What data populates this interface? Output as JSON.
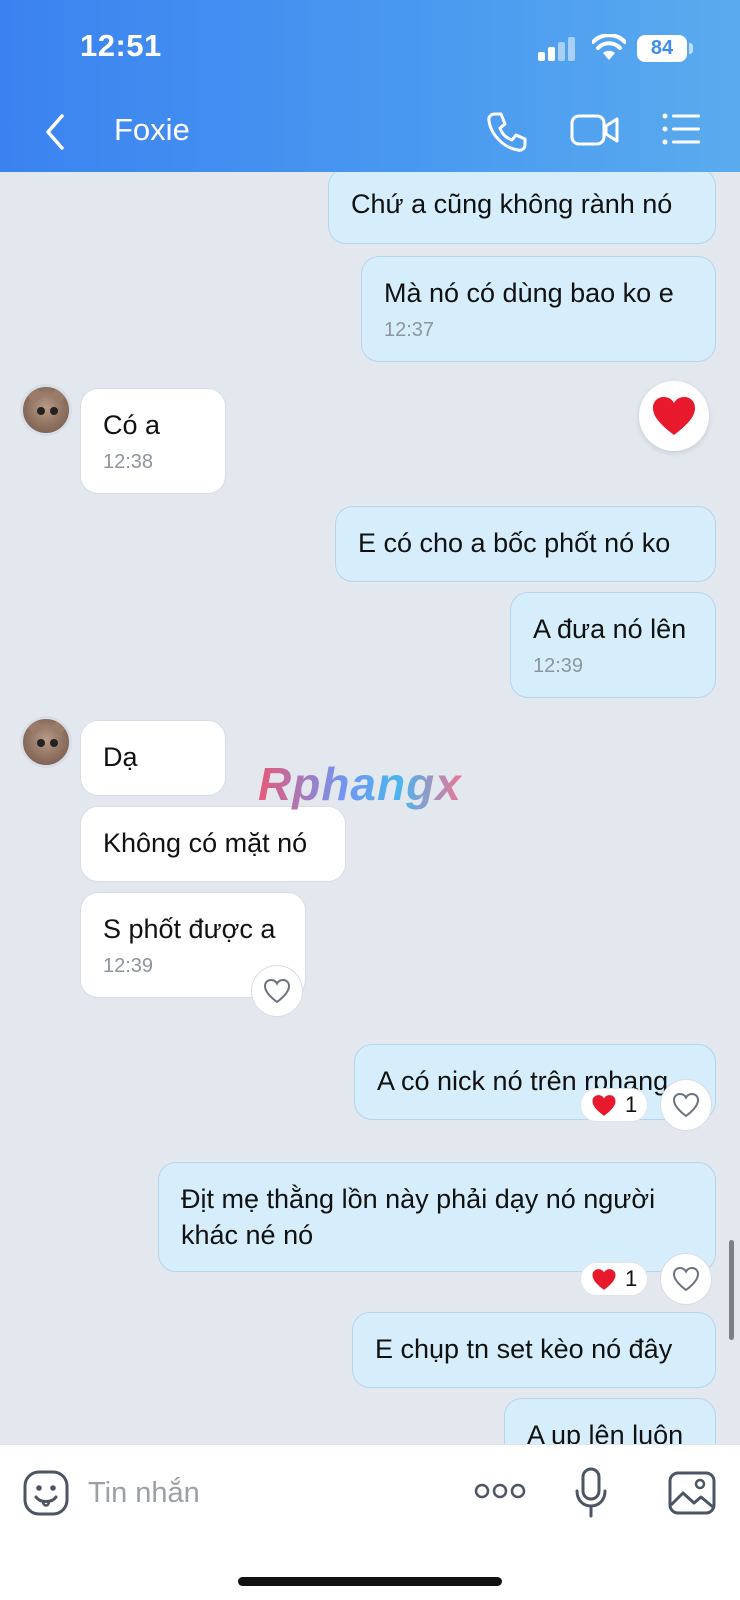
{
  "status_bar": {
    "time": "12:51",
    "battery": "84"
  },
  "header": {
    "title": "Foxie"
  },
  "watermark": "Rphangx",
  "messages": [
    {
      "text": "Chứ a cũng không rành nó",
      "time": ""
    },
    {
      "text": "Mà nó có dùng bao ko e",
      "time": "12:37"
    },
    {
      "text": "Có a",
      "time": "12:38"
    },
    {
      "text": "E có cho a bốc phốt nó ko",
      "time": ""
    },
    {
      "text": "A đưa nó lên",
      "time": "12:39"
    },
    {
      "text": "Dạ",
      "time": ""
    },
    {
      "text": "Không có mặt nó",
      "time": ""
    },
    {
      "text": "S phốt được a",
      "time": "12:39"
    },
    {
      "text": "A có nick nó trên rphang",
      "time": "",
      "reaction_count": "1"
    },
    {
      "text": "Địt mẹ thằng lồn này phải dạy nó người khác né nó",
      "time": "",
      "reaction_count": "1"
    },
    {
      "text": "E chụp tn set kèo nó đây",
      "time": ""
    },
    {
      "text": "A up lên luôn",
      "time": ""
    }
  ],
  "input": {
    "placeholder": "Tin nhắn"
  },
  "colors": {
    "header_start": "#3b82f0",
    "header_end": "#5aabee",
    "outgoing_bubble": "#d6eefc",
    "incoming_bubble": "#ffffff",
    "chat_background": "#e3e8ef",
    "heart": "#e8192c"
  },
  "icons": [
    "back-icon",
    "phone-icon",
    "video-icon",
    "menu-icon",
    "heart-icon",
    "like-icon",
    "emoji-icon",
    "more-icon",
    "mic-icon",
    "image-icon"
  ]
}
